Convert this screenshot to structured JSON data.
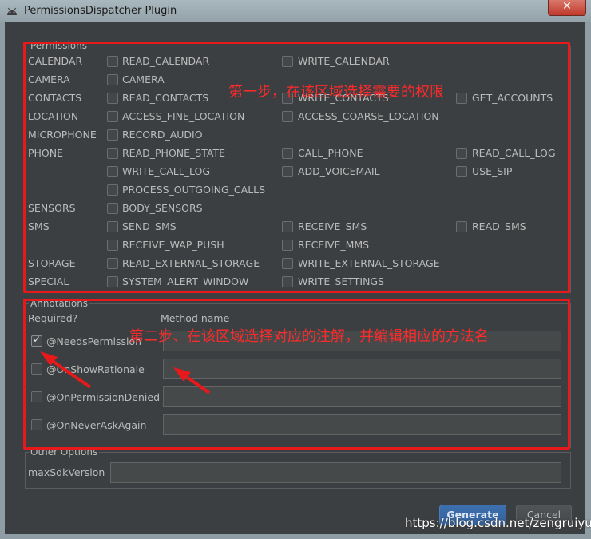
{
  "window": {
    "title": "PermissionsDispatcher Plugin",
    "close_glyph": "✕"
  },
  "permissions": {
    "group_title": "Permissions",
    "categories": {
      "calendar": "CALENDAR",
      "camera": "CAMERA",
      "contacts": "CONTACTS",
      "location": "LOCATION",
      "microphone": "MICROPHONE",
      "phone": "PHONE",
      "sensors": "SENSORS",
      "sms": "SMS",
      "storage": "STORAGE",
      "special": "SPECIAL"
    },
    "items": {
      "read_calendar": "READ_CALENDAR",
      "write_calendar": "WRITE_CALENDAR",
      "camera": "CAMERA",
      "read_contacts": "READ_CONTACTS",
      "write_contacts": "WRITE_CONTACTS",
      "get_accounts": "GET_ACCOUNTS",
      "access_fine_location": "ACCESS_FINE_LOCATION",
      "access_coarse_location": "ACCESS_COARSE_LOCATION",
      "record_audio": "RECORD_AUDIO",
      "read_phone_state": "READ_PHONE_STATE",
      "call_phone": "CALL_PHONE",
      "read_call_log": "READ_CALL_LOG",
      "write_call_log": "WRITE_CALL_LOG",
      "add_voicemail": "ADD_VOICEMAIL",
      "use_sip": "USE_SIP",
      "process_outgoing_calls": "PROCESS_OUTGOING_CALLS",
      "body_sensors": "BODY_SENSORS",
      "send_sms": "SEND_SMS",
      "receive_sms": "RECEIVE_SMS",
      "read_sms": "READ_SMS",
      "receive_wap_push": "RECEIVE_WAP_PUSH",
      "receive_mms": "RECEIVE_MMS",
      "read_external_storage": "READ_EXTERNAL_STORAGE",
      "write_external_storage": "WRITE_EXTERNAL_STORAGE",
      "system_alert_window": "SYSTEM_ALERT_WINDOW",
      "write_settings": "WRITE_SETTINGS"
    }
  },
  "annotations": {
    "group_title": "Annotations",
    "required_header": "Required?",
    "method_header": "Method name",
    "rows": [
      {
        "label": "@NeedsPermission",
        "checked": true,
        "method": ""
      },
      {
        "label": "@OnShowRationale",
        "checked": false,
        "method": ""
      },
      {
        "label": "@OnPermissionDenied",
        "checked": false,
        "method": ""
      },
      {
        "label": "@OnNeverAskAgain",
        "checked": false,
        "method": ""
      }
    ]
  },
  "other": {
    "group_title": "Other Options",
    "max_sdk_label": "maxSdkVersion",
    "max_sdk_value": ""
  },
  "buttons": {
    "generate": "Generate",
    "cancel": "Cancel"
  },
  "overlay": {
    "step1": "第一步，在该区域选择需要的权限",
    "step2": "第二步、在该区域选择对应的注解，并编辑相应的方法名",
    "watermark": "https://blog.csdn.net/zengruiyue",
    "annotation_color": "#e8191b"
  }
}
